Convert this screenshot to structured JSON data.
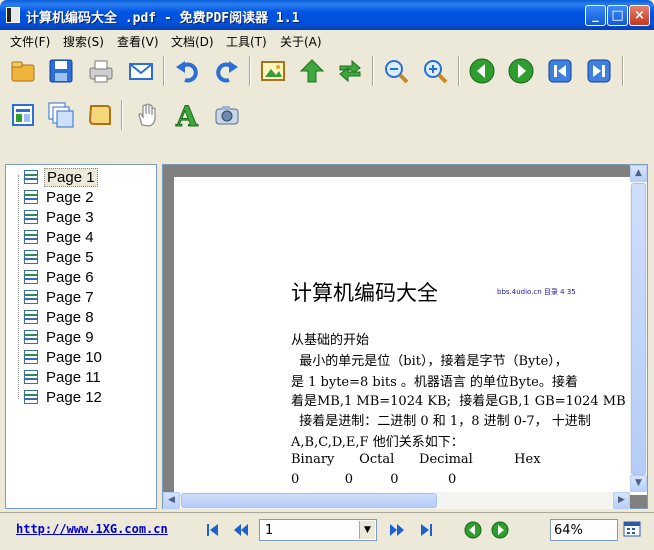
{
  "window": {
    "title": "计算机编码大全 .pdf - 免费PDF阅读器 1.1"
  },
  "menu": [
    "文件(F)",
    "搜索(S)",
    "查看(V)",
    "文档(D)",
    "工具(T)",
    "关于(A)"
  ],
  "toolbar1": [
    "open-folder-icon",
    "save-icon",
    "print-icon",
    "email-icon",
    "undo-icon",
    "redo-icon",
    "image-icon",
    "up-arrow-icon",
    "refresh-icon",
    "zoom-out-icon",
    "zoom-in-icon",
    "previous-icon",
    "next-icon",
    "first-page-icon",
    "last-page-icon"
  ],
  "toolbar2": [
    "single-page-icon",
    "multi-page-icon",
    "scroll-page-icon",
    "hand-tool-icon",
    "text-select-icon",
    "snapshot-icon"
  ],
  "sidebar": {
    "pages": [
      "Page 1",
      "Page 2",
      "Page 3",
      "Page 4",
      "Page 5",
      "Page 6",
      "Page 7",
      "Page 8",
      "Page 9",
      "Page 10",
      "Page 11",
      "Page 12"
    ],
    "selected": "Page 1"
  },
  "document": {
    "title": "计算机编码大全",
    "watermark": "bbs.4udio.cn 目录 4 35",
    "lines": [
      "从基础的开始",
      "  最小的单元是位（bit），接着是字节（Byte），",
      "是 1 byte=8 bits 。机器语言 的单位Byte。接着",
      "着是MB,1 MB=1024 KB;  接着是GB,1 GB=1024 MB",
      "  接着是进制：二进制 0 和 1，8 进制 0-7， 十进制",
      "A,B,C,D,E,F 他们关系如下：",
      "Binary      Octal      Decimal          Hex",
      "0           0         0            0"
    ]
  },
  "statusbar": {
    "url": "http://www.1XG.com.cn",
    "page_value": "1",
    "zoom_value": "64%"
  },
  "colors": {
    "title_bar": "#0054e3",
    "link": "#0000d0",
    "nav_green": "#2e9e2e",
    "nav_blue": "#1f5fd0"
  }
}
